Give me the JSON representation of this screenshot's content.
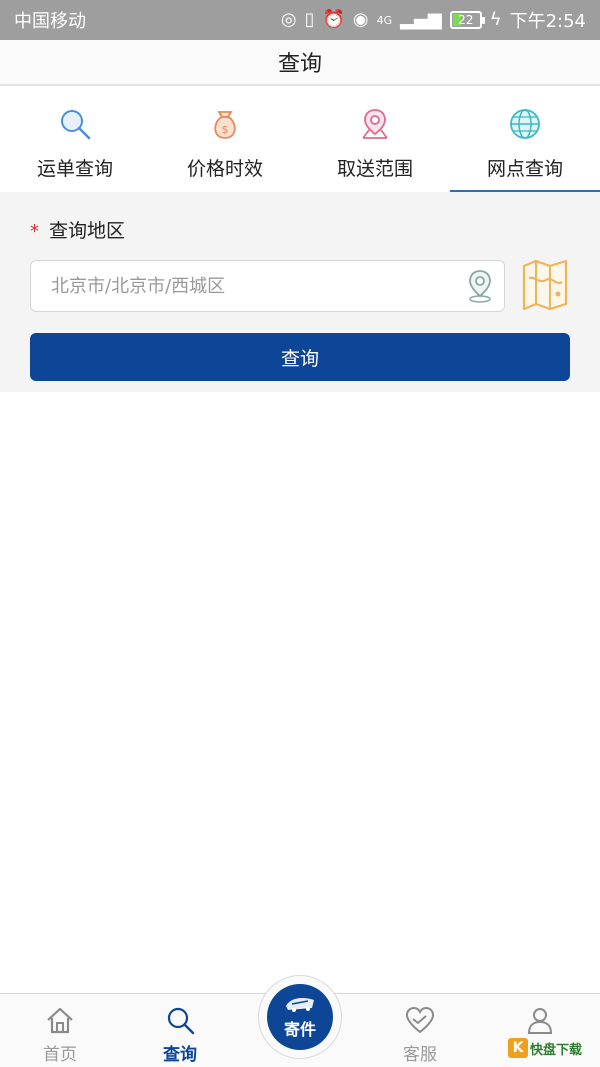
{
  "status_bar": {
    "carrier": "中国移动",
    "network": "4G",
    "battery": "22",
    "time": "下午2:54"
  },
  "nav": {
    "title": "查询"
  },
  "tabs": [
    {
      "label": "运单查询",
      "icon": "search-icon",
      "active": false
    },
    {
      "label": "价格时效",
      "icon": "money-bag-icon",
      "active": false
    },
    {
      "label": "取送范围",
      "icon": "location-pin-icon",
      "active": false
    },
    {
      "label": "网点查询",
      "icon": "globe-icon",
      "active": true
    }
  ],
  "form": {
    "region_label": "查询地区",
    "required_mark": "*",
    "region_placeholder": "北京市/北京市/西城区",
    "query_button": "查询"
  },
  "bottom_nav": {
    "items": [
      {
        "label": "首页",
        "icon": "home-icon",
        "active": false
      },
      {
        "label": "查询",
        "icon": "search-icon",
        "active": true
      },
      {
        "label": "寄件",
        "icon": "delivery-truck-icon",
        "active": false
      },
      {
        "label": "客服",
        "icon": "heart-handshake-icon",
        "active": false
      },
      {
        "label": "",
        "icon": "user-icon",
        "active": false
      }
    ]
  },
  "colors": {
    "primary": "#0d4697",
    "tab_indicator": "#2d6fb3",
    "required": "#d32f2f",
    "map_icon": "#f0b457"
  },
  "watermark": {
    "mark": "K",
    "text": "快盘下载"
  }
}
